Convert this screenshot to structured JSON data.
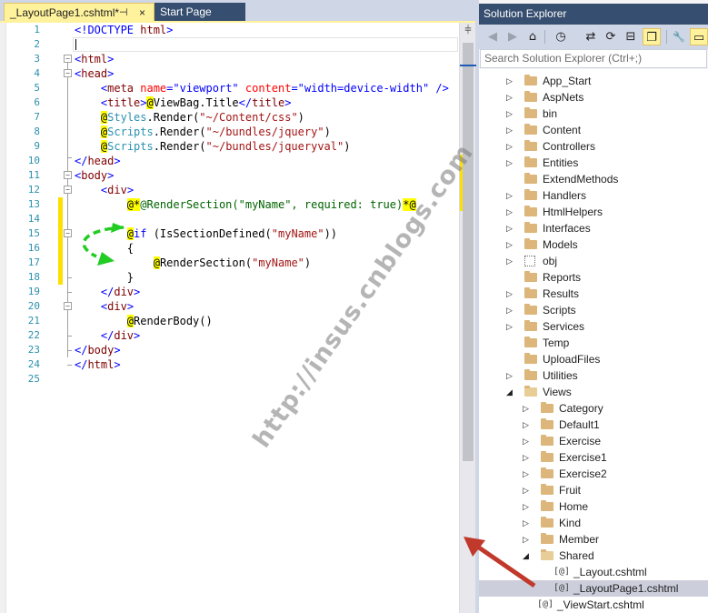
{
  "editor": {
    "tabs": [
      {
        "label": "_LayoutPage1.cshtml*",
        "active": true
      },
      {
        "label": "Start Page",
        "active": false
      }
    ],
    "pin_glyph": "⊣",
    "close_glyph": "×",
    "line_numbers": [
      "1",
      "2",
      "3",
      "4",
      "5",
      "6",
      "7",
      "8",
      "9",
      "10",
      "11",
      "12",
      "13",
      "14",
      "15",
      "16",
      "17",
      "18",
      "19",
      "20",
      "21",
      "22",
      "23",
      "24",
      "25"
    ],
    "lines": {
      "l1_a": "<!DOCTYPE ",
      "l1_b": "html",
      "l1_c": ">",
      "l3_a": "<",
      "l3_b": "html",
      "l3_c": ">",
      "l4_a": "<",
      "l4_b": "head",
      "l4_c": ">",
      "l5_a": "    <",
      "l5_b": "meta",
      "l5_c": " name",
      "l5_d": "=",
      "l5_e": "\"viewport\"",
      "l5_f": " content",
      "l5_g": "=",
      "l5_h": "\"width=device-width\"",
      "l5_i": " />",
      "l6_a": "    <",
      "l6_b": "title",
      "l6_c": ">",
      "l6_d": "@",
      "l6_e": "ViewBag.Title",
      "l6_f": "</",
      "l6_g": "title",
      "l6_h": ">",
      "l7_a": "    ",
      "l7_b": "@",
      "l7_c": "Styles",
      "l7_d": ".Render(",
      "l7_e": "\"~/Content/css\"",
      "l7_f": ")",
      "l8_a": "    ",
      "l8_b": "@",
      "l8_c": "Scripts",
      "l8_d": ".Render(",
      "l8_e": "\"~/bundles/jquery\"",
      "l8_f": ")",
      "l9_a": "    ",
      "l9_b": "@",
      "l9_c": "Scripts",
      "l9_d": ".Render(",
      "l9_e": "\"~/bundles/jqueryval\"",
      "l9_f": ")",
      "l10_a": "</",
      "l10_b": "head",
      "l10_c": ">",
      "l11_a": "<",
      "l11_b": "body",
      "l11_c": ">",
      "l12_a": "    <",
      "l12_b": "div",
      "l12_c": ">",
      "l13_a": "        ",
      "l13_b": "@*",
      "l13_c": "@RenderSection(\"myName\", required: true)",
      "l13_d": "*@",
      "l15_a": "        ",
      "l15_b": "@",
      "l15_c": "if",
      "l15_d": " (IsSectionDefined(",
      "l15_e": "\"myName\"",
      "l15_f": "))",
      "l16_a": "        {",
      "l17_a": "            ",
      "l17_b": "@",
      "l17_c": "RenderSection(",
      "l17_d": "\"myName\"",
      "l17_e": ")",
      "l18_a": "        }",
      "l19_a": "    </",
      "l19_b": "div",
      "l19_c": ">",
      "l20_a": "    <",
      "l20_b": "div",
      "l20_c": ">",
      "l21_a": "        ",
      "l21_b": "@",
      "l21_c": "RenderBody()",
      "l22_a": "    </",
      "l22_b": "div",
      "l22_c": ">",
      "l23_a": "</",
      "l23_b": "body",
      "l23_c": ">",
      "l24_a": "</",
      "l24_b": "html",
      "l24_c": ">"
    },
    "split_glyph": "⫩"
  },
  "solution_explorer": {
    "title": "Solution Explorer",
    "search_placeholder": "Search Solution Explorer (Ctrl+;)",
    "toolbar": {
      "back": "◀",
      "forward": "▶",
      "home": "⌂",
      "history": "◷",
      "sync": "⇄",
      "refresh": "⟳",
      "collapse": "⊟",
      "show_all": "❐",
      "properties": "🔧",
      "preview": "▭"
    },
    "items": [
      {
        "label": "App_Start",
        "kind": "folder",
        "level": 1,
        "expander": "▷"
      },
      {
        "label": "AspNets",
        "kind": "folder",
        "level": 1,
        "expander": "▷"
      },
      {
        "label": "bin",
        "kind": "folder",
        "level": 1,
        "expander": "▷"
      },
      {
        "label": "Content",
        "kind": "folder",
        "level": 1,
        "expander": "▷"
      },
      {
        "label": "Controllers",
        "kind": "folder",
        "level": 1,
        "expander": "▷"
      },
      {
        "label": "Entities",
        "kind": "folder",
        "level": 1,
        "expander": "▷"
      },
      {
        "label": "ExtendMethods",
        "kind": "folder",
        "level": 1,
        "expander": ""
      },
      {
        "label": "Handlers",
        "kind": "folder",
        "level": 1,
        "expander": "▷"
      },
      {
        "label": "HtmlHelpers",
        "kind": "folder",
        "level": 1,
        "expander": "▷"
      },
      {
        "label": "Interfaces",
        "kind": "folder",
        "level": 1,
        "expander": "▷"
      },
      {
        "label": "Models",
        "kind": "folder",
        "level": 1,
        "expander": "▷"
      },
      {
        "label": "obj",
        "kind": "hidden-folder",
        "level": 1,
        "expander": "▷"
      },
      {
        "label": "Reports",
        "kind": "folder",
        "level": 1,
        "expander": ""
      },
      {
        "label": "Results",
        "kind": "folder",
        "level": 1,
        "expander": "▷"
      },
      {
        "label": "Scripts",
        "kind": "folder",
        "level": 1,
        "expander": "▷"
      },
      {
        "label": "Services",
        "kind": "folder",
        "level": 1,
        "expander": "▷"
      },
      {
        "label": "Temp",
        "kind": "folder",
        "level": 1,
        "expander": ""
      },
      {
        "label": "UploadFiles",
        "kind": "folder",
        "level": 1,
        "expander": ""
      },
      {
        "label": "Utilities",
        "kind": "folder",
        "level": 1,
        "expander": "▷"
      },
      {
        "label": "Views",
        "kind": "folder-open",
        "level": 1,
        "expander": "◢"
      },
      {
        "label": "Category",
        "kind": "folder",
        "level": 2,
        "expander": "▷"
      },
      {
        "label": "Default1",
        "kind": "folder",
        "level": 2,
        "expander": "▷"
      },
      {
        "label": "Exercise",
        "kind": "folder",
        "level": 2,
        "expander": "▷"
      },
      {
        "label": "Exercise1",
        "kind": "folder",
        "level": 2,
        "expander": "▷"
      },
      {
        "label": "Exercise2",
        "kind": "folder",
        "level": 2,
        "expander": "▷"
      },
      {
        "label": "Fruit",
        "kind": "folder",
        "level": 2,
        "expander": "▷"
      },
      {
        "label": "Home",
        "kind": "folder",
        "level": 2,
        "expander": "▷"
      },
      {
        "label": "Kind",
        "kind": "folder",
        "level": 2,
        "expander": "▷"
      },
      {
        "label": "Member",
        "kind": "folder",
        "level": 2,
        "expander": "▷"
      },
      {
        "label": "Shared",
        "kind": "folder-open",
        "level": 2,
        "expander": "◢"
      },
      {
        "label": "_Layout.cshtml",
        "kind": "razor",
        "level": 3,
        "expander": ""
      },
      {
        "label": "_LayoutPage1.cshtml",
        "kind": "razor",
        "level": 3,
        "expander": "",
        "selected": true
      },
      {
        "label": "_ViewStart.cshtml",
        "kind": "razor",
        "level": 2,
        "expander": ""
      }
    ],
    "razor_glyph": "[@]"
  },
  "watermark": "http://insus.cnblogs.com",
  "colors": {
    "tab_active": "#fff29d",
    "title_bar": "#364e6f",
    "change_margin": "#fce100",
    "annotation_arrow_green": "#22cc22",
    "annotation_arrow_red": "#c0392b"
  }
}
